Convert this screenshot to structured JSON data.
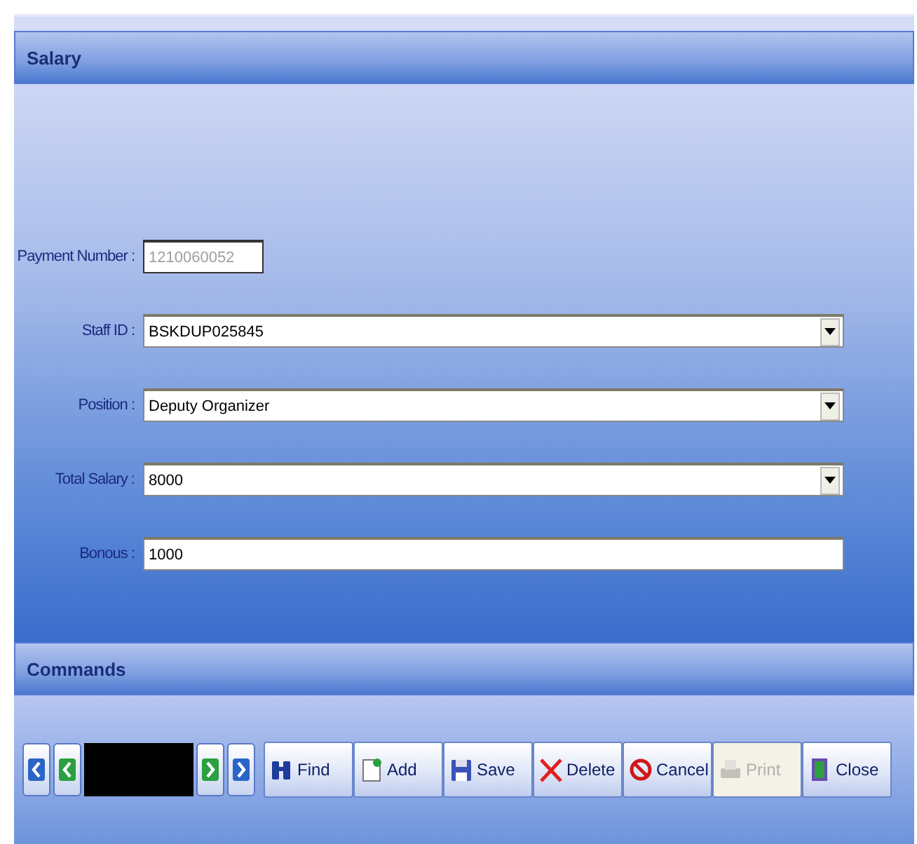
{
  "form": {
    "title": "Salary",
    "fields": [
      {
        "label": "Payment Number :",
        "value": "1210060052",
        "kind": "text",
        "disabled": true
      },
      {
        "label": "Staff ID :",
        "value": "BSKDUP025845",
        "kind": "dropdown",
        "disabled": false
      },
      {
        "label": "Position :",
        "value": "Deputy Organizer",
        "kind": "dropdown",
        "disabled": false
      },
      {
        "label": "Total Salary :",
        "value": "8000",
        "kind": "dropdown",
        "disabled": false
      },
      {
        "label": "Bonous :",
        "value": "1000",
        "kind": "text",
        "disabled": false
      }
    ]
  },
  "commands": {
    "title": "Commands",
    "navigation": [
      {
        "kind": "first"
      },
      {
        "kind": "previous"
      },
      {
        "kind": "record"
      },
      {
        "kind": "next"
      },
      {
        "kind": "last"
      }
    ],
    "buttons": [
      {
        "label": "Find",
        "kind": "find",
        "disabled": false
      },
      {
        "label": "Add",
        "kind": "add",
        "disabled": false
      },
      {
        "label": "Save",
        "kind": "save",
        "disabled": false
      },
      {
        "label": "Delete",
        "kind": "delete",
        "disabled": false
      },
      {
        "label": "Cancel",
        "kind": "cancel",
        "disabled": false
      },
      {
        "label": "Print",
        "kind": "print",
        "disabled": true
      },
      {
        "label": "Close",
        "kind": "close",
        "disabled": false
      }
    ]
  }
}
